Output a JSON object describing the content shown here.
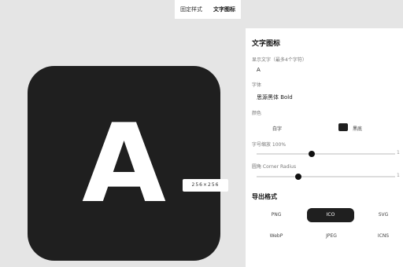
{
  "tabs": [
    {
      "label": "固定样式",
      "active": false
    },
    {
      "label": "文字图标",
      "active": true
    }
  ],
  "preview": {
    "letter": "A",
    "background_color": "#1f1f1f",
    "size_badge": "256×256"
  },
  "panel": {
    "title": "文字图标",
    "text_label": "显示文字（最多4个字符）",
    "text_value": "A",
    "font_label": "字体",
    "font_value": "思源黑体 Bold",
    "color_label": "颜色",
    "color_options": [
      {
        "label": "白字",
        "selected": false
      },
      {
        "label": "黑底",
        "selected": true
      }
    ],
    "size_label": "字号缩放 100%",
    "size_level": 0.4,
    "radius_label": "圆角 Corner Radius",
    "radius_level": 0.3,
    "slider_end": "1"
  },
  "export": {
    "title": "导出格式",
    "formats": [
      {
        "label": "PNG",
        "active": false
      },
      {
        "label": "ICO",
        "active": true
      },
      {
        "label": "SVG",
        "active": false
      },
      {
        "label": "WebP",
        "active": false
      },
      {
        "label": "JPEG",
        "active": false
      },
      {
        "label": "ICNS",
        "active": false
      }
    ]
  },
  "colors": {
    "accent": "#1f1f1f",
    "background": "#e5e5e5",
    "panel": "#ffffff"
  }
}
